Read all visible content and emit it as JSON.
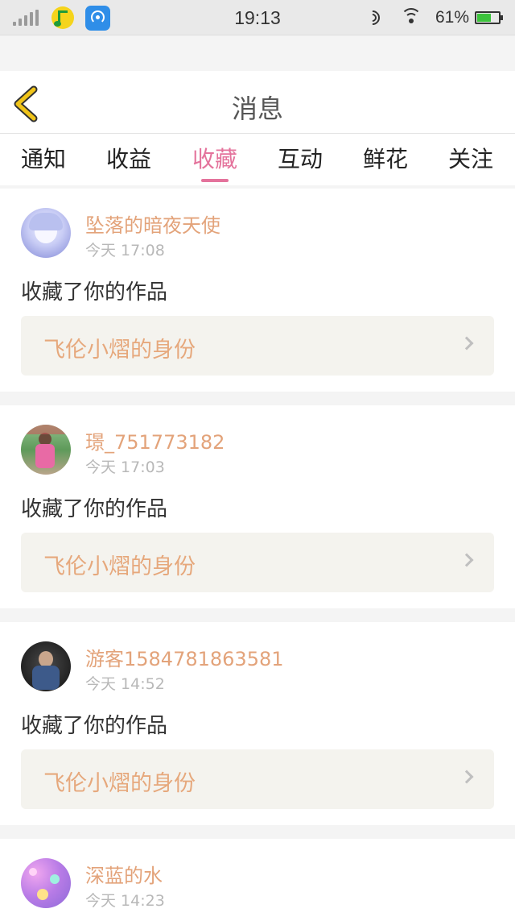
{
  "status_bar": {
    "time": "19:13",
    "battery": "61%"
  },
  "header": {
    "title": "消息"
  },
  "tabs": [
    {
      "label": "通知",
      "active": false
    },
    {
      "label": "收益",
      "active": false
    },
    {
      "label": "收藏",
      "active": true
    },
    {
      "label": "互动",
      "active": false
    },
    {
      "label": "鲜花",
      "active": false
    },
    {
      "label": "关注",
      "active": false
    }
  ],
  "items": [
    {
      "username": "坠落的暗夜天使",
      "time": "今天 17:08",
      "action": "收藏了你的作品",
      "work_title": "飞伦小熠的身份"
    },
    {
      "username": "璟_751773182",
      "time": "今天 17:03",
      "action": "收藏了你的作品",
      "work_title": "飞伦小熠的身份"
    },
    {
      "username": "游客1584781863581",
      "time": "今天 14:52",
      "action": "收藏了你的作品",
      "work_title": "飞伦小熠的身份"
    },
    {
      "username": "深蓝的水",
      "time": "今天 14:23"
    }
  ],
  "colors": {
    "accent": "#e4739c",
    "username": "#e3a37a",
    "back_arrow": "#f0c419"
  }
}
